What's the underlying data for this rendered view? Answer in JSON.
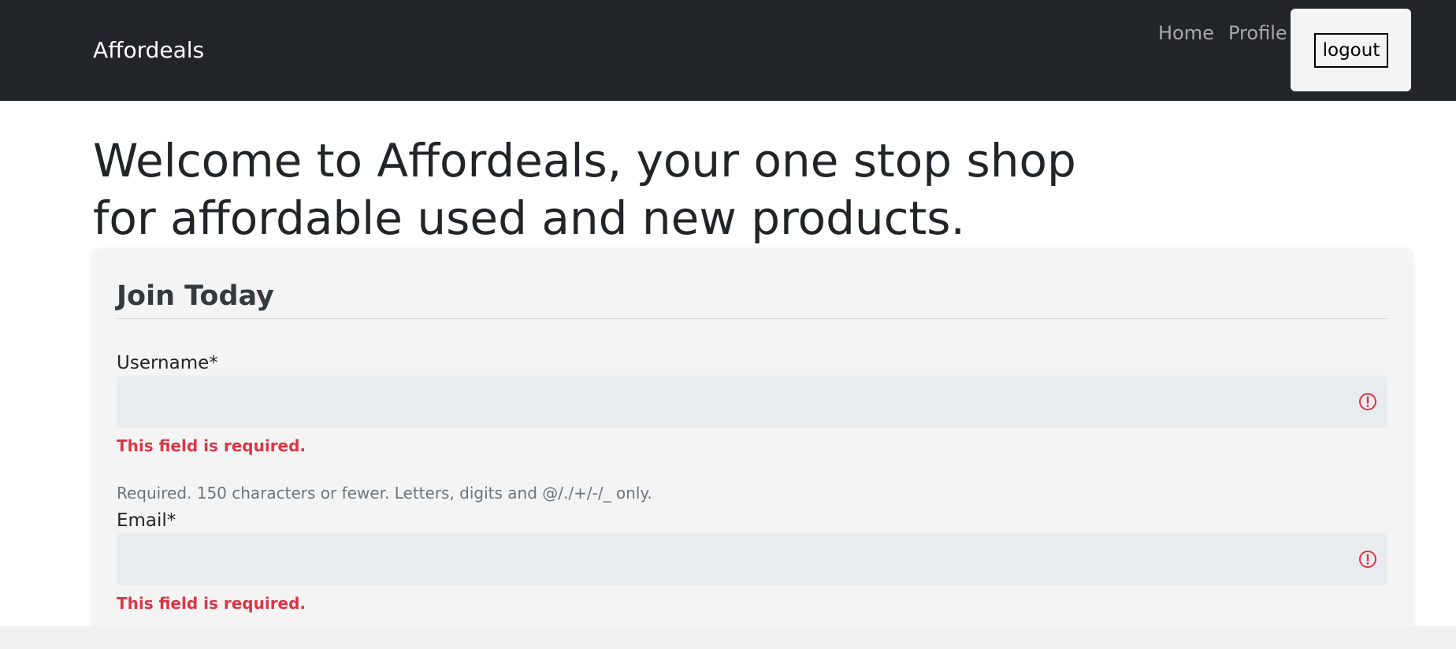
{
  "navbar": {
    "brand": "Affordeals",
    "links": [
      {
        "label": "Home"
      },
      {
        "label": "Profile"
      }
    ],
    "logout_label": "logout"
  },
  "hero": {
    "title": "Welcome to Affordeals, your one stop shop for affordable used and new products."
  },
  "form": {
    "legend": "Join Today",
    "fields": {
      "username": {
        "label": "Username*",
        "value": "",
        "error": "This field is required.",
        "help": "Required. 150 characters or fewer. Letters, digits and @/./+/-/_ only."
      },
      "email": {
        "label": "Email*",
        "value": "",
        "error": "This field is required."
      }
    }
  },
  "colors": {
    "navbar_bg": "#212529",
    "error": "#dc3545",
    "card_bg": "#f4f4f4",
    "input_bg": "#e9ecef"
  },
  "icons": {
    "field_error": "exclamation-circle-icon"
  }
}
